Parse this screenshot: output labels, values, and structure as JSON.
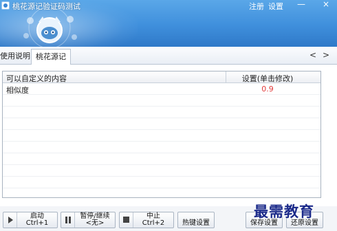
{
  "window": {
    "title": "桃花源记验证码测试",
    "register_link": "注册",
    "settings_link": "设置",
    "minimize_glyph": "—",
    "close_glyph": "×"
  },
  "tabs": {
    "items": [
      {
        "label": "使用说明",
        "active": false
      },
      {
        "label": "桃花源记",
        "active": true
      }
    ],
    "scroll_left": "<",
    "scroll_right": ">"
  },
  "grid": {
    "headers": {
      "name": "可以自定义的内容",
      "setting": "设置(单击修改)"
    },
    "rows": [
      {
        "name": "相似度",
        "value": "0.9",
        "value_color": "#e23b3b"
      }
    ]
  },
  "toolbar": {
    "start": {
      "label": "启动",
      "shortcut": "Ctrl+1"
    },
    "pause": {
      "label": "暂停/继续",
      "shortcut": "<无>"
    },
    "stop": {
      "label": "中止",
      "shortcut": "Ctrl+2"
    },
    "hotkey": {
      "label": "热键设置"
    },
    "save": {
      "label": "保存设置"
    },
    "restore": {
      "label": "还原设置"
    }
  },
  "watermark": "最需教育",
  "colors": {
    "banner": "#3f8fdc",
    "value_red": "#e23b3b"
  }
}
